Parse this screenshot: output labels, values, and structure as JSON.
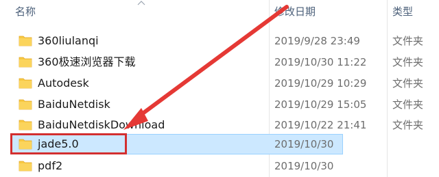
{
  "header": {
    "name": "名称",
    "date": "修改日期",
    "type": "类型"
  },
  "rows": [
    {
      "name": "360liulanqi",
      "date": "2019/9/28 23:49",
      "type": "文件夹"
    },
    {
      "name": "360极速浏览器下载",
      "date": "2019/10/30 11:22",
      "type": "文件夹"
    },
    {
      "name": "Autodesk",
      "date": "2019/10/29 10:29",
      "type": "文件夹"
    },
    {
      "name": "BaiduNetdisk",
      "date": "2019/10/29 15:05",
      "type": "文件夹"
    },
    {
      "name": "BaiduNetdiskDownload",
      "date": "2019/10/22 21:41",
      "type": "文件夹"
    },
    {
      "name": "jade5.0",
      "date": "2019/10/30",
      "type": ""
    },
    {
      "name": "pdf2",
      "date": "2019/10/30",
      "type": ""
    }
  ],
  "selected_row": "jade5.0",
  "colors": {
    "selection": "#cce8ff",
    "annotation": "#d32f2f",
    "folder": "#f8c942"
  },
  "icons": {
    "folder": "folder-icon",
    "sort": "sort-up-chevron-icon",
    "annotation": "red-arrow-annotation"
  }
}
